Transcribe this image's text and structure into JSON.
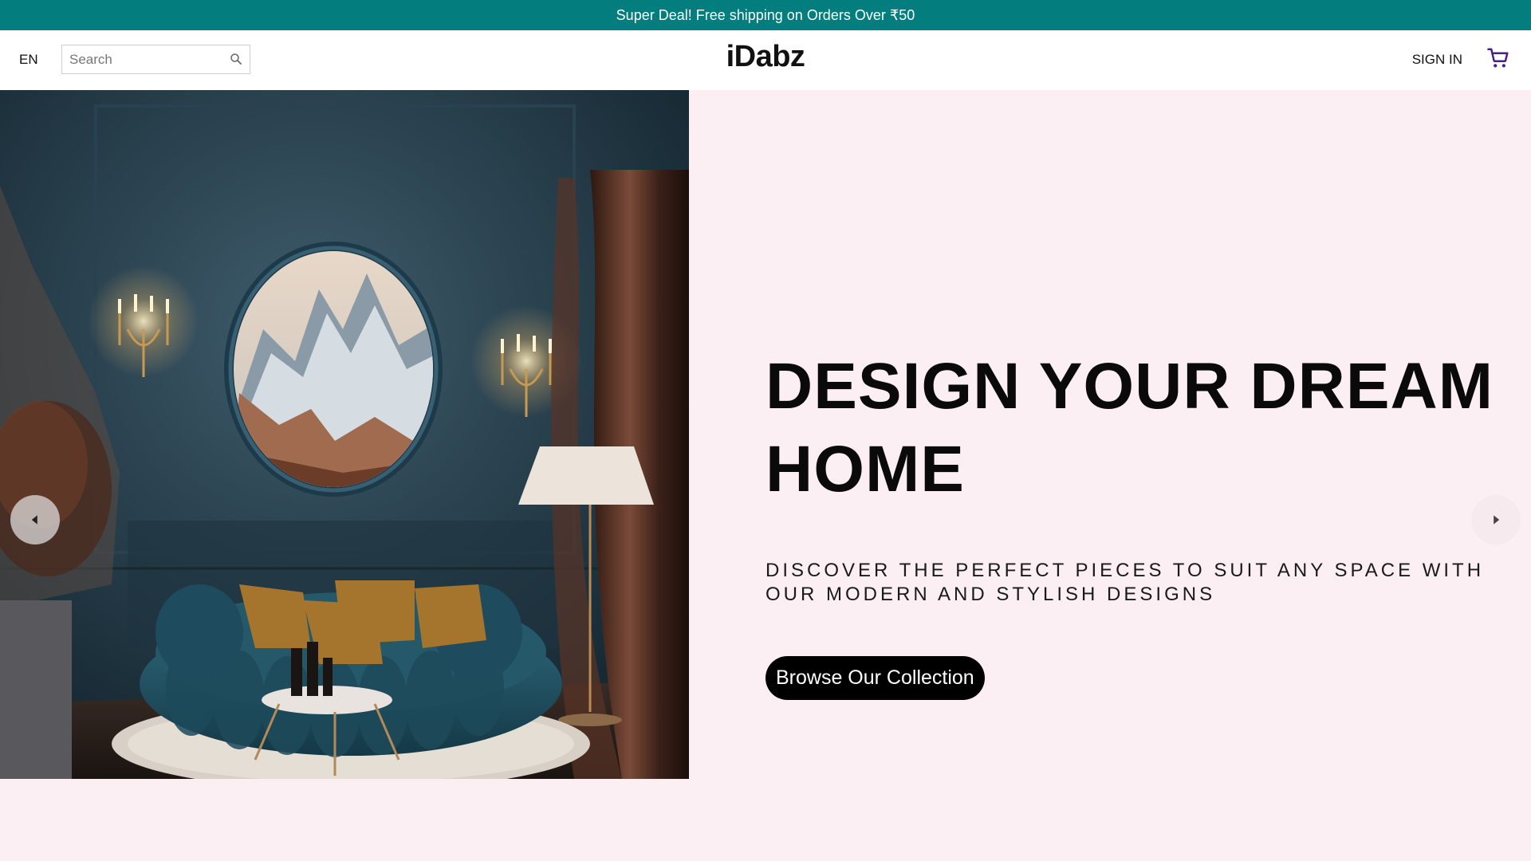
{
  "promo": {
    "text": "Super Deal! Free shipping on Orders Over ₹50"
  },
  "header": {
    "language": "EN",
    "search_placeholder": "Search",
    "logo": "iDabz",
    "sign_in": "SIGN IN",
    "cart_icon": "cart-icon",
    "search_icon": "search-icon"
  },
  "hero": {
    "title": "DESIGN YOUR DREAM HOME",
    "subtitle": "DISCOVER THE PERFECT PIECES TO SUIT ANY SPACE WITH OUR MODERN AND STYLISH DESIGNS",
    "cta": "Browse Our Collection",
    "prev_icon": "chevron-left-icon",
    "next_icon": "chevron-right-icon"
  },
  "colors": {
    "promo_bg": "#037d7e",
    "page_bg": "#fbeff3",
    "cart_icon": "#4b1f8a",
    "cta_bg": "#000000"
  }
}
